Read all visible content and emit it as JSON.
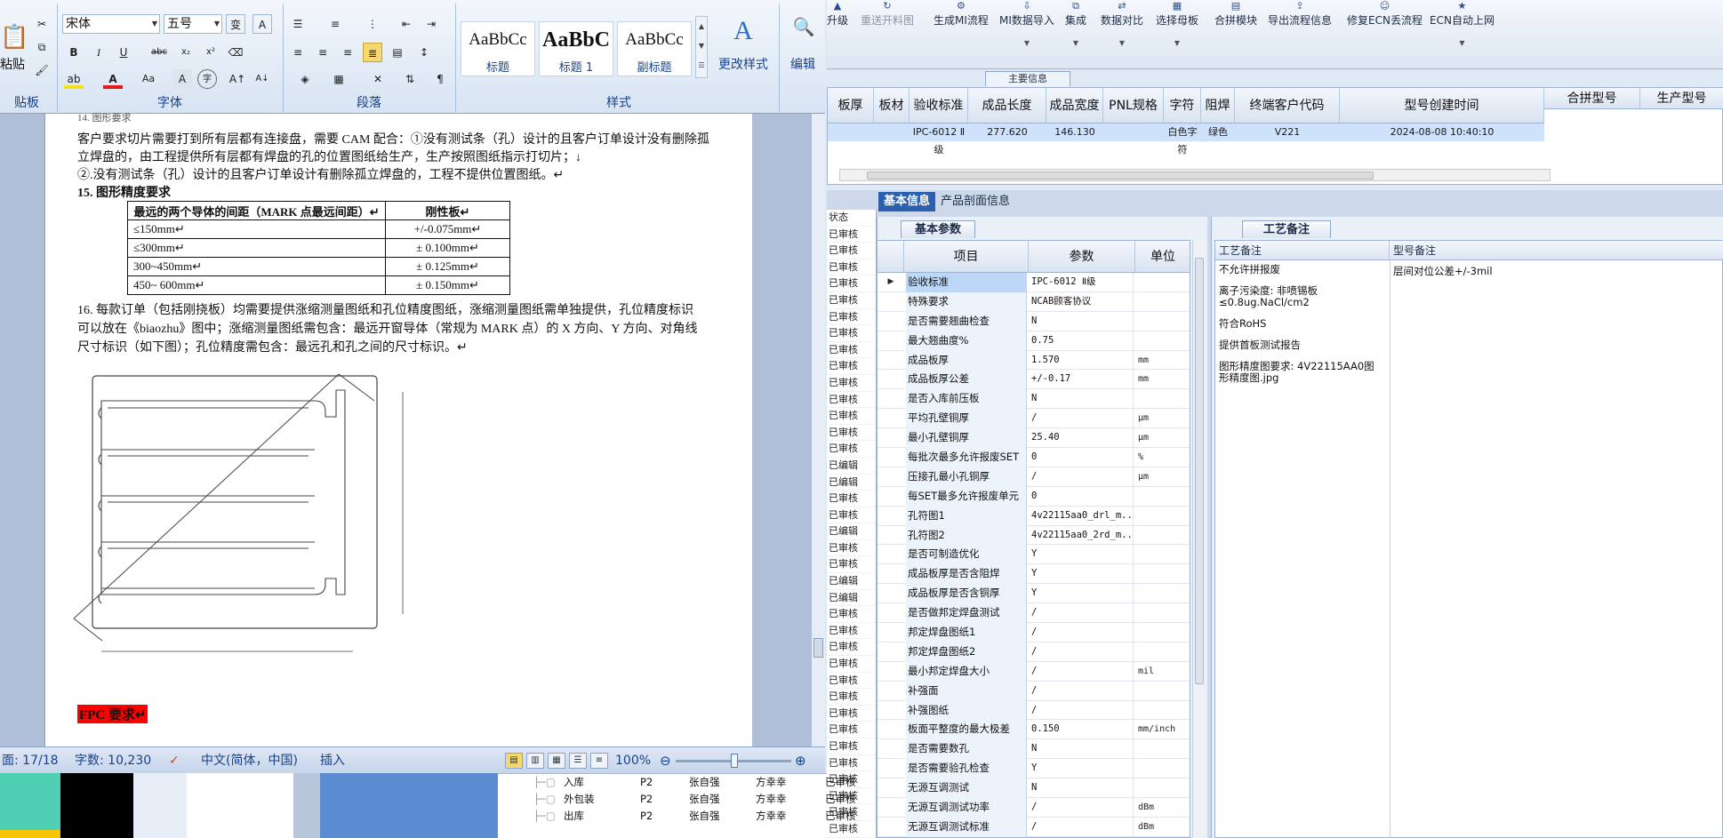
{
  "erp": {
    "toolbar": [
      {
        "label": "升级",
        "icon": "upgrade-icon",
        "glyph": "▲",
        "enabled": true
      },
      {
        "label": "重送开料图",
        "icon": "resend-icon",
        "glyph": "↻",
        "enabled": false
      },
      {
        "label": "生成MI流程",
        "icon": "flow-icon",
        "glyph": "⚙",
        "enabled": true
      },
      {
        "label": "MI数据导入",
        "icon": "import-icon",
        "glyph": "⇩",
        "enabled": true,
        "dropdown": true
      },
      {
        "label": "集成",
        "icon": "integrate-icon",
        "glyph": "⧉",
        "enabled": true,
        "dropdown": true
      },
      {
        "label": "数据对比",
        "icon": "compare-icon",
        "glyph": "⇄",
        "enabled": true,
        "dropdown": true
      },
      {
        "label": "选择母板",
        "icon": "board-icon",
        "glyph": "▦",
        "enabled": true,
        "dropdown": true
      },
      {
        "label": "合拼模块",
        "icon": "merge-icon",
        "glyph": "▤",
        "enabled": true
      },
      {
        "label": "导出流程信息",
        "icon": "export-icon",
        "glyph": "⇪",
        "enabled": true
      },
      {
        "label": "修复ECN丢流程",
        "icon": "repair-icon",
        "glyph": "☺",
        "enabled": true
      },
      {
        "label": "ECN自动上网",
        "icon": "star-icon",
        "glyph": "★",
        "enabled": true,
        "dropdown": true
      }
    ],
    "main_info_tab": "主要信息",
    "top_grid": {
      "headers": [
        "板厚",
        "板材",
        "验收标准",
        "成品长度",
        "成品宽度",
        "PNL规格",
        "字符",
        "阻焊",
        "终端客户代码",
        "型号创建时间",
        "合拼型号",
        "生产型号"
      ],
      "row": [
        "",
        "",
        "IPC-6012 Ⅱ级",
        "277.620",
        "146.130",
        "",
        "白色字符",
        "绿色",
        "V221",
        "2024-08-08 10:40:10",
        "",
        ""
      ]
    },
    "detail_tabs": [
      "基本信息",
      "产品剖面信息"
    ],
    "status_col": {
      "header": "状态",
      "rows": [
        "已审核",
        "已审核",
        "已审核",
        "已审核",
        "已审核",
        "已审核",
        "已审核",
        "已审核",
        "已审核",
        "已审核",
        "已审核",
        "已审核",
        "已审核",
        "已审核",
        "已编辑",
        "已编辑",
        "已审核",
        "已审核",
        "已编辑",
        "已审核",
        "已审核",
        "已编辑",
        "已编辑",
        "已审核",
        "已审核",
        "已审核",
        "已审核",
        "已审核",
        "已审核",
        "已审核",
        "已审核",
        "已审核",
        "已审核",
        "已审核",
        "已审核",
        "已审核",
        "已审核",
        "已审核"
      ]
    },
    "basic_params": {
      "tab": "基本参数",
      "headers": [
        "项目",
        "参数",
        "单位"
      ],
      "rows": [
        [
          "验收标准",
          "IPC-6012 Ⅱ级",
          ""
        ],
        [
          "特殊要求",
          "NCAB顾客协议",
          ""
        ],
        [
          "是否需要翘曲检查",
          "N",
          ""
        ],
        [
          "最大翘曲度%",
          "0.75",
          ""
        ],
        [
          "成品板厚",
          "1.570",
          "mm"
        ],
        [
          "成品板厚公差",
          "+/-0.17",
          "mm"
        ],
        [
          "是否入库前压板",
          "N",
          ""
        ],
        [
          "平均孔壁铜厚",
          "/",
          "μm"
        ],
        [
          "最小孔壁铜厚",
          "25.40",
          "μm"
        ],
        [
          "每批次最多允许报废SET",
          "0",
          "%"
        ],
        [
          "压接孔最小孔铜厚",
          "/",
          "μm"
        ],
        [
          "每SET最多允许报废单元",
          "0",
          ""
        ],
        [
          "孔符图1",
          "4v22115aa0_drl_m...",
          ""
        ],
        [
          "孔符图2",
          "4v22115aa0_2rd_m...",
          ""
        ],
        [
          "是否可制造优化",
          "Y",
          ""
        ],
        [
          "成品板厚是否含阻焊",
          "Y",
          ""
        ],
        [
          "成品板厚是否含铜厚",
          "Y",
          ""
        ],
        [
          "是否做邦定焊盘测试",
          "/",
          ""
        ],
        [
          "邦定焊盘图纸1",
          "/",
          ""
        ],
        [
          "邦定焊盘图纸2",
          "/",
          ""
        ],
        [
          "最小邦定焊盘大小",
          "/",
          "mil"
        ],
        [
          "补强面",
          "/",
          ""
        ],
        [
          "补强图纸",
          "/",
          ""
        ],
        [
          "板面平整度的最大极差",
          "0.150",
          "mm/inch"
        ],
        [
          "是否需要数孔",
          "N",
          ""
        ],
        [
          "是否需要验孔检查",
          "Y",
          ""
        ],
        [
          "无源互调测试",
          "N",
          ""
        ],
        [
          "无源互调测试功率",
          "/",
          "dBm"
        ],
        [
          "无源互调测试标准",
          "/",
          "dBm"
        ]
      ]
    },
    "process_notes": {
      "tab": "工艺备注",
      "headers": [
        "工艺备注",
        "型号备注"
      ],
      "notes": [
        "不允许拼报废",
        "离子污染度: 非喷锡板≤0.8ug.NaCl/cm2",
        "符合RoHS",
        "提供首板测试报告",
        "图形精度图要求: 4V22115AA0图形精度图.jpg"
      ],
      "model_note": "层间对位公差+/-3mil"
    },
    "bottom_list": [
      {
        "name": "入库",
        "c1": "P2",
        "c2": "张自强",
        "c3": "方幸幸",
        "c4": "已审核"
      },
      {
        "name": "外包装",
        "c1": "P2",
        "c2": "张自强",
        "c3": "方幸幸",
        "c4": "已审核"
      },
      {
        "name": "出库",
        "c1": "P2",
        "c2": "张自强",
        "c3": "方幸幸",
        "c4": "已审核"
      }
    ]
  },
  "word": {
    "font_name": "宋体",
    "font_size": "五号",
    "styles": [
      {
        "sample": "AaBbCc",
        "name": "标题"
      },
      {
        "sample": "AaBbC",
        "name": "标题 1"
      },
      {
        "sample": "AaBbCc",
        "name": "副标题"
      }
    ],
    "change_styles": "更改样式",
    "edit": "编辑",
    "paste": "粘贴",
    "groups": {
      "clipboard": "贴板",
      "font": "字体",
      "paragraph": "段落",
      "styles": "样式"
    },
    "doc": {
      "cut_heading": "14. 图形要求",
      "p1a": "客户要求切片需要打到所有层都有连接盘，需要 CAM 配合：①没有测试条（孔）设计的且客户订单设计没有删除孤",
      "p1b": "立焊盘的，由工程提供所有层都有焊盘的孔的位置图纸给生产，生产按照图纸指示打切片；↓",
      "p1c": "②.没有测试条（孔）设计的且客户订单设计有删除孤立焊盘的，工程不提供位置图纸。↵",
      "h15": "15. 图形精度要求",
      "table_head": [
        "最远的两个导体的间距（MARK 点最远间距）↵",
        "刚性板↵"
      ],
      "table_rows": [
        [
          "≤150mm↵",
          "+/-0.075mm↵"
        ],
        [
          "≤300mm↵",
          "± 0.100mm↵"
        ],
        [
          "300~450mm↵",
          "± 0.125mm↵"
        ],
        [
          "450~ 600mm↵",
          "± 0.150mm↵"
        ]
      ],
      "p16a": "16.  每款订单（包括刚挠板）均需要提供涨缩测量图纸和孔位精度图纸，涨缩测量图纸需单独提供，孔位精度标识",
      "p16b": "可以放在《biaozhu》图中；涨缩测量图纸需包含：最远开窗导体（常规为 MARK 点）的 X 方向、Y 方向、对角线",
      "p16c": "尺寸标识（如下图）；孔位精度需包含：最远孔和孔之间的尺寸标识。↵",
      "fpc": "FPC 要求↵"
    },
    "status": {
      "page": "面: 17/18",
      "words": "字数: 10,230",
      "lang": "中文(简体，中国)",
      "mode": "插入",
      "zoom": "100%"
    }
  }
}
